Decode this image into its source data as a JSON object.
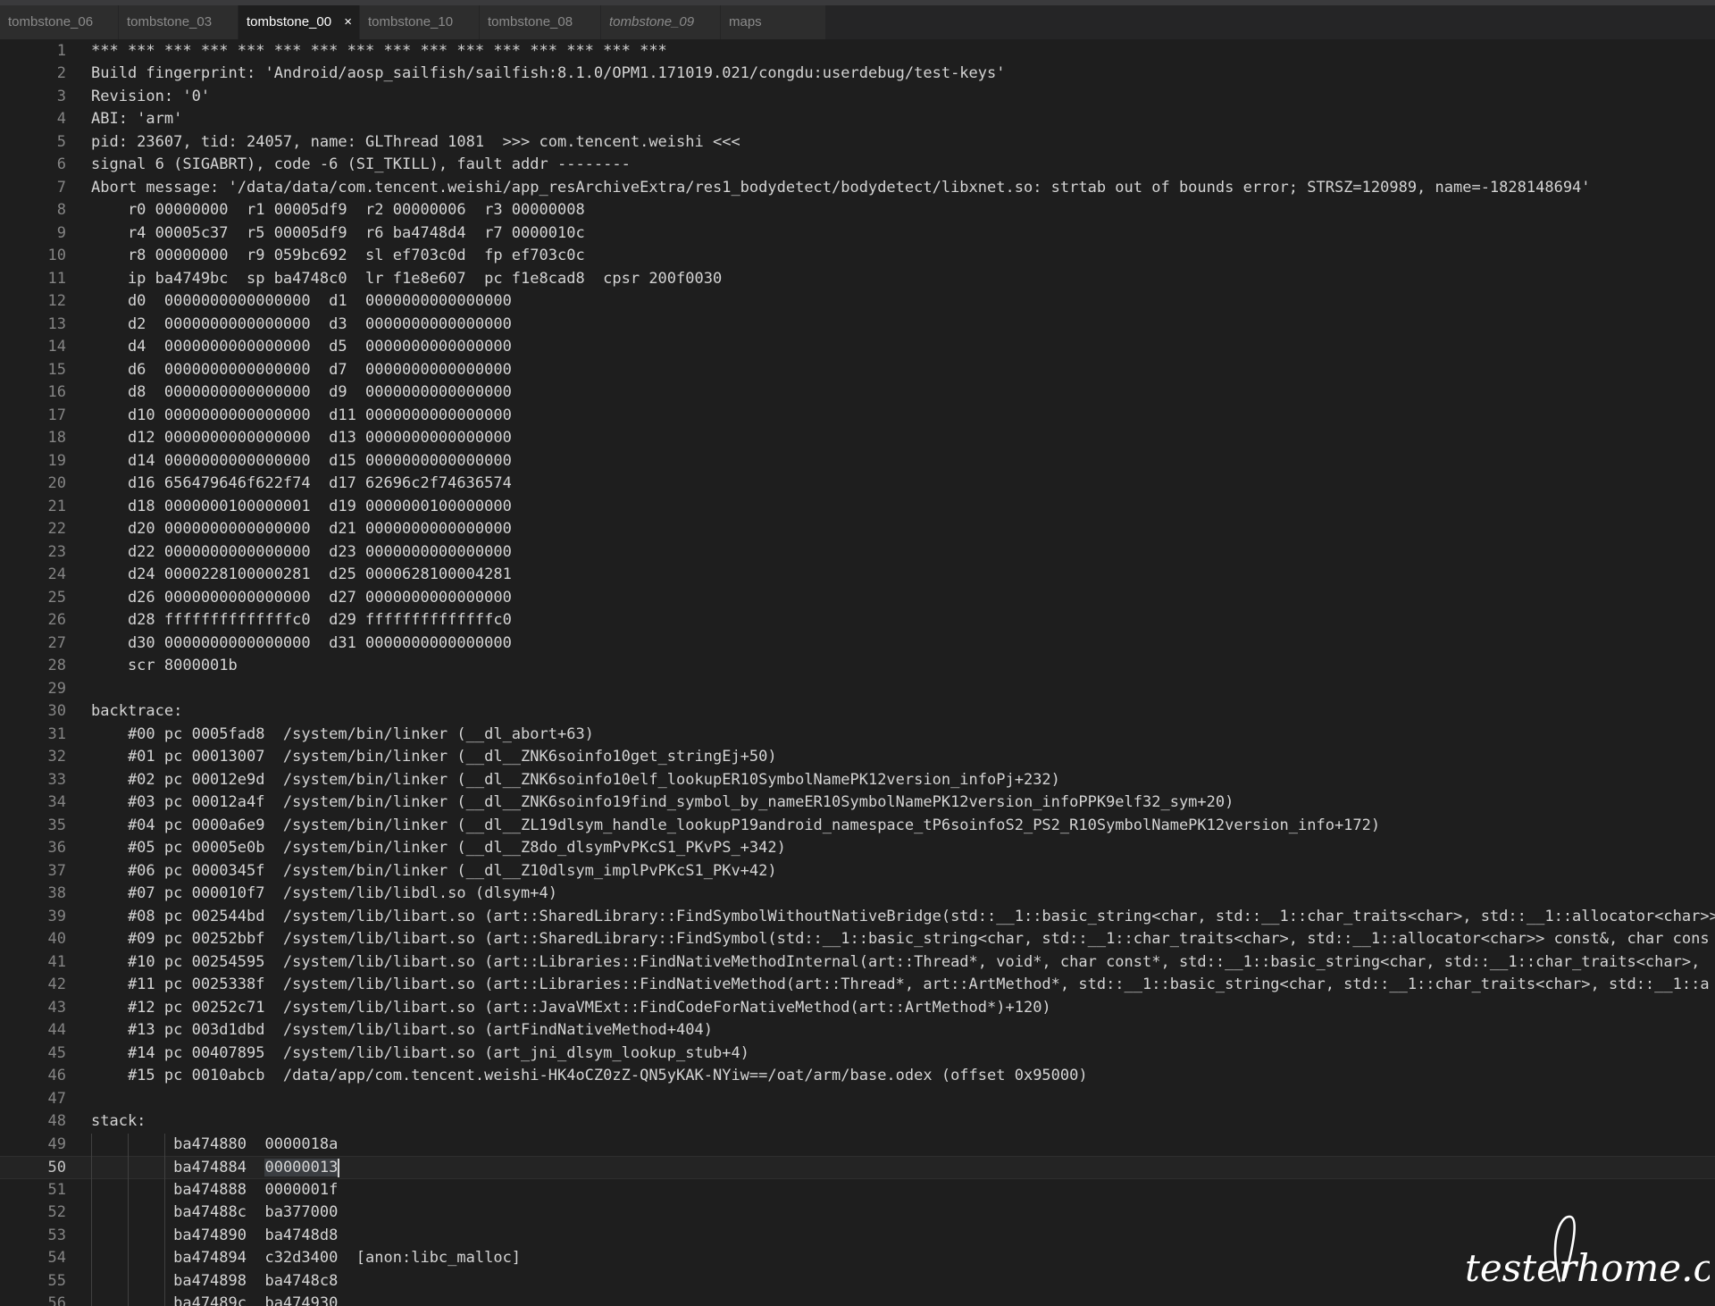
{
  "tabs": [
    {
      "label": "tombstone_06",
      "active": false,
      "preview": false,
      "closable": false
    },
    {
      "label": "tombstone_03",
      "active": false,
      "preview": false,
      "closable": false
    },
    {
      "label": "tombstone_00",
      "active": true,
      "preview": false,
      "closable": true
    },
    {
      "label": "tombstone_10",
      "active": false,
      "preview": false,
      "closable": false
    },
    {
      "label": "tombstone_08",
      "active": false,
      "preview": false,
      "closable": false
    },
    {
      "label": "tombstone_09",
      "active": false,
      "preview": true,
      "closable": false
    },
    {
      "label": "maps",
      "active": false,
      "preview": false,
      "closable": false
    }
  ],
  "close_glyph": "×",
  "editor": {
    "current_line": 50,
    "lines": [
      {
        "n": "1",
        "text": "*** *** *** *** *** *** *** *** *** *** *** *** *** *** *** ***"
      },
      {
        "n": "2",
        "text": "Build fingerprint: 'Android/aosp_sailfish/sailfish:8.1.0/OPM1.171019.021/congdu:userdebug/test-keys'"
      },
      {
        "n": "3",
        "text": "Revision: '0'"
      },
      {
        "n": "4",
        "text": "ABI: 'arm'"
      },
      {
        "n": "5",
        "text": "pid: 23607, tid: 24057, name: GLThread 1081  >>> com.tencent.weishi <<<"
      },
      {
        "n": "6",
        "text": "signal 6 (SIGABRT), code -6 (SI_TKILL), fault addr --------"
      },
      {
        "n": "7",
        "text": "Abort message: '/data/data/com.tencent.weishi/app_resArchiveExtra/res1_bodydetect/bodydetect/libxnet.so: strtab out of bounds error; STRSZ=120989, name=-1828148694'"
      },
      {
        "n": "8",
        "text": "    r0 00000000  r1 00005df9  r2 00000006  r3 00000008"
      },
      {
        "n": "9",
        "text": "    r4 00005c37  r5 00005df9  r6 ba4748d4  r7 0000010c"
      },
      {
        "n": "10",
        "text": "    r8 00000000  r9 059bc692  sl ef703c0d  fp ef703c0c"
      },
      {
        "n": "11",
        "text": "    ip ba4749bc  sp ba4748c0  lr f1e8e607  pc f1e8cad8  cpsr 200f0030"
      },
      {
        "n": "12",
        "text": "    d0  0000000000000000  d1  0000000000000000"
      },
      {
        "n": "13",
        "text": "    d2  0000000000000000  d3  0000000000000000"
      },
      {
        "n": "14",
        "text": "    d4  0000000000000000  d5  0000000000000000"
      },
      {
        "n": "15",
        "text": "    d6  0000000000000000  d7  0000000000000000"
      },
      {
        "n": "16",
        "text": "    d8  0000000000000000  d9  0000000000000000"
      },
      {
        "n": "17",
        "text": "    d10 0000000000000000  d11 0000000000000000"
      },
      {
        "n": "18",
        "text": "    d12 0000000000000000  d13 0000000000000000"
      },
      {
        "n": "19",
        "text": "    d14 0000000000000000  d15 0000000000000000"
      },
      {
        "n": "20",
        "text": "    d16 656479646f622f74  d17 62696c2f74636574"
      },
      {
        "n": "21",
        "text": "    d18 0000000100000001  d19 0000000100000000"
      },
      {
        "n": "22",
        "text": "    d20 0000000000000000  d21 0000000000000000"
      },
      {
        "n": "23",
        "text": "    d22 0000000000000000  d23 0000000000000000"
      },
      {
        "n": "24",
        "text": "    d24 0000228100000281  d25 0000628100004281"
      },
      {
        "n": "25",
        "text": "    d26 0000000000000000  d27 0000000000000000"
      },
      {
        "n": "26",
        "text": "    d28 ffffffffffffffc0  d29 ffffffffffffffc0"
      },
      {
        "n": "27",
        "text": "    d30 0000000000000000  d31 0000000000000000"
      },
      {
        "n": "28",
        "text": "    scr 8000001b"
      },
      {
        "n": "29",
        "text": ""
      },
      {
        "n": "30",
        "text": "backtrace:"
      },
      {
        "n": "31",
        "text": "    #00 pc 0005fad8  /system/bin/linker (__dl_abort+63)"
      },
      {
        "n": "32",
        "text": "    #01 pc 00013007  /system/bin/linker (__dl__ZNK6soinfo10get_stringEj+50)"
      },
      {
        "n": "33",
        "text": "    #02 pc 00012e9d  /system/bin/linker (__dl__ZNK6soinfo10elf_lookupER10SymbolNamePK12version_infoPj+232)"
      },
      {
        "n": "34",
        "text": "    #03 pc 00012a4f  /system/bin/linker (__dl__ZNK6soinfo19find_symbol_by_nameER10SymbolNamePK12version_infoPPK9elf32_sym+20)"
      },
      {
        "n": "35",
        "text": "    #04 pc 0000a6e9  /system/bin/linker (__dl__ZL19dlsym_handle_lookupP19android_namespace_tP6soinfoS2_PS2_R10SymbolNamePK12version_info+172)"
      },
      {
        "n": "36",
        "text": "    #05 pc 00005e0b  /system/bin/linker (__dl__Z8do_dlsymPvPKcS1_PKvPS_+342)"
      },
      {
        "n": "37",
        "text": "    #06 pc 0000345f  /system/bin/linker (__dl__Z10dlsym_implPvPKcS1_PKv+42)"
      },
      {
        "n": "38",
        "text": "    #07 pc 000010f7  /system/lib/libdl.so (dlsym+4)"
      },
      {
        "n": "39",
        "text": "    #08 pc 002544bd  /system/lib/libart.so (art::SharedLibrary::FindSymbolWithoutNativeBridge(std::__1::basic_string<char, std::__1::char_traits<char>, std::__1::allocator<char>>"
      },
      {
        "n": "40",
        "text": "    #09 pc 00252bbf  /system/lib/libart.so (art::SharedLibrary::FindSymbol(std::__1::basic_string<char, std::__1::char_traits<char>, std::__1::allocator<char>> const&, char cons"
      },
      {
        "n": "41",
        "text": "    #10 pc 00254595  /system/lib/libart.so (art::Libraries::FindNativeMethodInternal(art::Thread*, void*, char const*, std::__1::basic_string<char, std::__1::char_traits<char>,"
      },
      {
        "n": "42",
        "text": "    #11 pc 0025338f  /system/lib/libart.so (art::Libraries::FindNativeMethod(art::Thread*, art::ArtMethod*, std::__1::basic_string<char, std::__1::char_traits<char>, std::__1::a"
      },
      {
        "n": "43",
        "text": "    #12 pc 00252c71  /system/lib/libart.so (art::JavaVMExt::FindCodeForNativeMethod(art::ArtMethod*)+120)"
      },
      {
        "n": "44",
        "text": "    #13 pc 003d1dbd  /system/lib/libart.so (artFindNativeMethod+404)"
      },
      {
        "n": "45",
        "text": "    #14 pc 00407895  /system/lib/libart.so (art_jni_dlsym_lookup_stub+4)"
      },
      {
        "n": "46",
        "text": "    #15 pc 0010abcb  /data/app/com.tencent.weishi-HK4oCZ0zZ-QN5yKAK-NYiw==/oat/arm/base.odex (offset 0x95000)"
      },
      {
        "n": "47",
        "text": ""
      },
      {
        "n": "48",
        "text": "stack:"
      },
      {
        "n": "49",
        "text": "         ba474880  0000018a"
      },
      {
        "n": "50",
        "text": "         ba474884  00000013"
      },
      {
        "n": "51",
        "text": "         ba474888  0000001f"
      },
      {
        "n": "52",
        "text": "         ba47488c  ba377000"
      },
      {
        "n": "53",
        "text": "         ba474890  ba4748d8"
      },
      {
        "n": "54",
        "text": "         ba474894  c32d3400  [anon:libc_malloc]"
      },
      {
        "n": "55",
        "text": "         ba474898  ba4748c8"
      },
      {
        "n": "56",
        "text": "         ba47489c  ba474930"
      }
    ]
  },
  "watermark": {
    "text": "testerhome.com"
  }
}
